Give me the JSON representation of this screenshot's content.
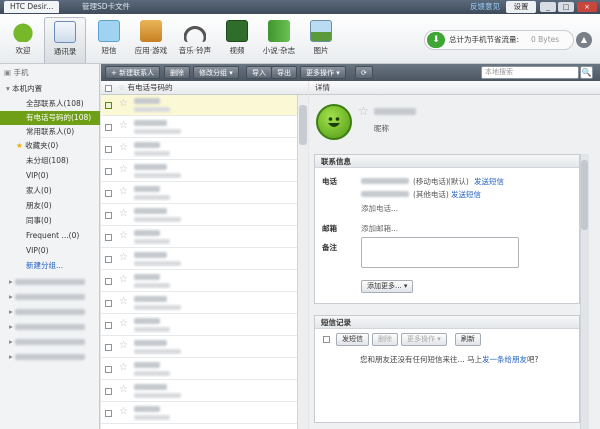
{
  "titlebar": {
    "device_tab": "HTC Desir...",
    "manage_sd": "管理SD卡文件",
    "feedback": "反馈意见",
    "settings": "设置",
    "min": "_",
    "max": "□",
    "close": "×"
  },
  "toolbar": {
    "items": [
      {
        "label": "欢迎",
        "icon": "android-robot-icon",
        "color": "#76b82a"
      },
      {
        "label": "通讯录",
        "icon": "contacts-icon",
        "color": "#4a8bd0"
      },
      {
        "label": "短信",
        "icon": "sms-icon",
        "color": "#7cc1e8"
      },
      {
        "label": "应用·游戏",
        "icon": "apps-games-icon",
        "color": "#d89a3a"
      },
      {
        "label": "音乐·铃声",
        "icon": "headphones-icon",
        "color": "#555555"
      },
      {
        "label": "视频",
        "icon": "video-icon",
        "color": "#2f6d2a"
      },
      {
        "label": "小说·杂志",
        "icon": "book-icon",
        "color": "#4aa53c"
      },
      {
        "label": "图片",
        "icon": "picture-icon",
        "color": "#67a8d8"
      }
    ],
    "active_index": 1,
    "traffic_label": "总计为手机节省流量:",
    "traffic_value": "0 Bytes",
    "traffic_toggle": "▲"
  },
  "sidebar": {
    "phone": "手机",
    "local": "本机内置",
    "items": [
      {
        "label": "全部联系人(108)"
      },
      {
        "label": "有电话号码的(108)"
      },
      {
        "label": "常用联系人(0)"
      },
      {
        "label": "收藏夹(0)"
      },
      {
        "label": "未分组(108)"
      },
      {
        "label": "VIP(0)"
      },
      {
        "label": "家人(0)"
      },
      {
        "label": "朋友(0)"
      },
      {
        "label": "同事(0)"
      },
      {
        "label": "Frequent ...(0)"
      },
      {
        "label": "VIP(0)"
      },
      {
        "label": "新建分组..."
      }
    ],
    "accounts": [
      {
        "label": "▸"
      },
      {
        "label": "▸"
      },
      {
        "label": "▸"
      },
      {
        "label": "▸"
      },
      {
        "label": "▸"
      },
      {
        "label": "▸"
      }
    ]
  },
  "listbar": {
    "new_contact": "+ 新建联系人",
    "delete": "删除",
    "modify_group": "修改分组 ▾",
    "import": "导入",
    "export": "导出",
    "more": "更多操作 ▾",
    "refresh": "⟳",
    "search_placeholder": "本地搜索",
    "search_icon": "🔍"
  },
  "list": {
    "header": "有电话号码的",
    "row_count": 15,
    "selected_index": 0
  },
  "detail": {
    "header": "详情",
    "remark": "昵称",
    "contact_info_title": "联系信息",
    "phone_label": "电话",
    "phone1_type": "(移动电话)",
    "phone1_default": "(默认)",
    "phone2_type": "(其他电话)",
    "send_sms": "发送短信",
    "add_phone": "添加电话...",
    "email_label": "邮箱",
    "add_email": "添加邮箱...",
    "notes_label": "备注",
    "add_more": "添加更多... ▾",
    "sms_title": "短信记录",
    "send_sms_btn": "发短信",
    "delete_btn": "删除",
    "more_ops_btn": "更多操作 ▾",
    "refresh_btn": "刷新",
    "sms_empty": "您和朋友还没有任何短信来往... 马上",
    "sms_empty_link": "发一条给朋友",
    "sms_empty_end": "吧?"
  }
}
